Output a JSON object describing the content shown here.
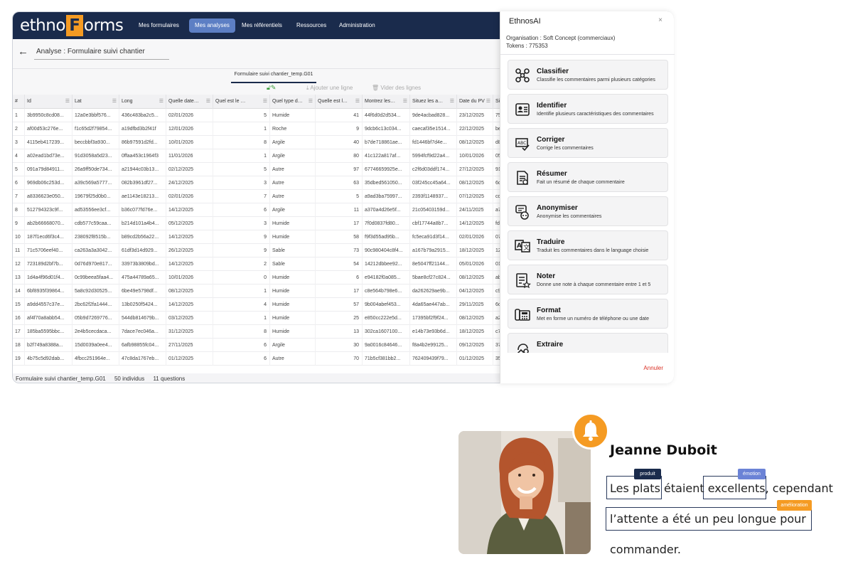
{
  "app": {
    "logo_left": "ethno",
    "logo_box": "F",
    "logo_right": "orms",
    "nav": [
      {
        "label": "Mes formulaires"
      },
      {
        "label": "Mes analyses"
      },
      {
        "label": "Mes référentiels"
      },
      {
        "label": "Ressources"
      },
      {
        "label": "Administration"
      }
    ],
    "page_title": "Analyse : Formulaire suivi chantier",
    "tab": "Formulaire suivi chantier_temp.G01",
    "toolbar": {
      "add_label": "Ajouter une ligne",
      "clear_label": "Vider des lignes"
    }
  },
  "table": {
    "headers": [
      "#",
      "Id",
      "Lat",
      "Long",
      "Quelle date…",
      "Quel est le …",
      "Quel type d…",
      "Quelle est l…",
      "Montrez les…",
      "Situez les a…",
      "Date du PV",
      "Sig"
    ],
    "rows": [
      [
        "1",
        "3b9950c8cd08...",
        "12a0e3bbf576...",
        "436c483ba2c5...",
        "02/01/2026",
        "5",
        "Humide",
        "41",
        "44f6d0d2d534...",
        "9de4acbad828...",
        "23/12/2025",
        "75"
      ],
      [
        "2",
        "af00d53c276e...",
        "f1c65d2f79854...",
        "a19dfbd3b2f41f",
        "12/01/2026",
        "1",
        "Roche",
        "9",
        "9dcb6c13c034...",
        "caecaf35e1514...",
        "22/12/2025",
        "be"
      ],
      [
        "3",
        "4115eb417239...",
        "beccbbf3a930...",
        "86b97591d2fd...",
        "10/01/2026",
        "8",
        "Argile",
        "40",
        "b7de718861ae...",
        "fd1446bf7d4e...",
        "08/12/2025",
        "d8"
      ],
      [
        "4",
        "a02ead1bd73e...",
        "91d3058a5d23...",
        "0ffaa453c1964f3",
        "11/01/2026",
        "1",
        "Argile",
        "80",
        "41c122a817af...",
        "5994fcf9d22a4...",
        "10/01/2026",
        "05"
      ],
      [
        "5",
        "091a79d84911...",
        "26a9ff50de734...",
        "a21944c03b13...",
        "02/12/2025",
        "5",
        "Autre",
        "97",
        "67746659925e...",
        "c2f6d03ddf174...",
        "27/12/2025",
        "91"
      ],
      [
        "6",
        "969db06c253d...",
        "a39c569a5777...",
        "082b3961df27...",
        "24/12/2025",
        "3",
        "Autre",
        "63",
        "35dbed561050...",
        "03f245cc45a64...",
        "08/12/2025",
        "6c"
      ],
      [
        "7",
        "a8336623e050...",
        "19679f25d0b0...",
        "ae1143e18213...",
        "02/01/2026",
        "7",
        "Autre",
        "5",
        "a9ad3ba75997...",
        "2393f1148937...",
        "07/12/2025",
        "cd"
      ],
      [
        "8",
        "512794323c9f...",
        "ad53556ee3cf...",
        "b36c077fd76e...",
        "14/12/2025",
        "6",
        "Argile",
        "11",
        "a370a4d26e5f...",
        "21c05403159d...",
        "24/11/2025",
        "a7"
      ],
      [
        "9",
        "ab2b66668070...",
        "cdb577c59caa...",
        "b214d101a4b4...",
        "05/12/2025",
        "3",
        "Humide",
        "17",
        "7f0d0837fd80...",
        "cbf17744a8b7...",
        "14/12/2025",
        "fd"
      ],
      [
        "10",
        "187f1ecd6f3c4...",
        "238092f8515b...",
        "b89cd2b56a22...",
        "14/12/2025",
        "9",
        "Humide",
        "58",
        "f9f3d55ad95b...",
        "fc5eca91d3f14...",
        "02/01/2026",
        "07"
      ],
      [
        "11",
        "71c5706eef40...",
        "ca263a3a3042...",
        "61df3d14d929...",
        "26/12/2025",
        "9",
        "Sable",
        "73",
        "90c980404c8f4...",
        "a167b79a2915...",
        "18/12/2025",
        "12"
      ],
      [
        "12",
        "723189d2bf7b...",
        "0d76d970e817...",
        "33973b3809bd...",
        "14/12/2025",
        "2",
        "Sable",
        "54",
        "14212dbbee92...",
        "8e5047ff21144...",
        "05/01/2026",
        "01"
      ],
      [
        "13",
        "1d4a4f96d01f4...",
        "0c99beea5faa4...",
        "475a44789a65...",
        "10/01/2026",
        "0",
        "Humide",
        "6",
        "e94182f0a085...",
        "5bae8cf27c824...",
        "08/12/2025",
        "ab"
      ],
      [
        "14",
        "6bf8935f39864...",
        "5a8c92d30525...",
        "6be49e5798df...",
        "08/12/2025",
        "1",
        "Humide",
        "17",
        "c8e564b798e6...",
        "da262629ae9b...",
        "04/12/2025",
        "c9"
      ],
      [
        "15",
        "a9dd4557c37e...",
        "2bc62f2fa1444...",
        "13b0250f5424...",
        "14/12/2025",
        "4",
        "Humide",
        "57",
        "9b004abef453...",
        "4da65ae447ab...",
        "29/11/2025",
        "6c"
      ],
      [
        "16",
        "af4f70a8abb54...",
        "05b9d7269776...",
        "544db814679b...",
        "03/12/2025",
        "1",
        "Humide",
        "25",
        "e850cc222e5d...",
        "17395bf2f9f24...",
        "08/12/2025",
        "a2"
      ],
      [
        "17",
        "185ba5595bbc...",
        "2e4b5cecdaca...",
        "7dace7ec046a...",
        "31/12/2025",
        "8",
        "Humide",
        "13",
        "302ca1607100...",
        "e14b73e93b6d...",
        "18/12/2025",
        "c7"
      ],
      [
        "18",
        "b2f749a8388a...",
        "15d0039a0ee4...",
        "6afb98855fc04...",
        "27/11/2025",
        "6",
        "Argile",
        "30",
        "9a0016c84646...",
        "f8a4b2e99125...",
        "09/12/2025",
        "37"
      ],
      [
        "19",
        "4b75c5d92dab...",
        "4fbcc251964e...",
        "47c8da1767eb...",
        "01/12/2025",
        "6",
        "Autre",
        "70",
        "71b5cf381bb2...",
        "762409439f79...",
        "01/12/2025",
        "35"
      ]
    ]
  },
  "status": {
    "form": "Formulaire suivi chantier_temp.G01",
    "individus": "50 individus",
    "questions": "11 questions"
  },
  "ai_panel": {
    "title": "EthnosAI",
    "close": "×",
    "organisation": "Organisation :  Soft Concept (commerciaux)",
    "tokens": "Tokens :  775353",
    "actions": [
      {
        "name": "Classifier",
        "desc": "Classifie les commentaires parmi plusieurs catégories",
        "icon": "network-icon"
      },
      {
        "name": "Identifier",
        "desc": "Identifie plusieurs caractéristiques des commentaires",
        "icon": "id-card-icon"
      },
      {
        "name": "Corriger",
        "desc": "Corrige les commentaires",
        "icon": "spellcheck-icon"
      },
      {
        "name": "Résumer",
        "desc": "Fait un résumé de chaque commentaire",
        "icon": "document-icon"
      },
      {
        "name": "Anonymiser",
        "desc": "Anonymise les commentaires",
        "icon": "anonymous-icon"
      },
      {
        "name": "Traduire",
        "desc": "Traduit les commentaires dans le language choisie",
        "icon": "translate-icon"
      },
      {
        "name": "Noter",
        "desc": "Donne une note à chaque commentaire entre 1 et 5",
        "icon": "rating-icon"
      },
      {
        "name": "Format",
        "desc": "Met en forme un numéro de téléphone ou une date",
        "icon": "phone-format-icon"
      },
      {
        "name": "Extraire",
        "desc": "",
        "icon": "extract-icon"
      }
    ],
    "cancel": "Annuler"
  },
  "review": {
    "name": "Jeanne Duboit",
    "line1_a": "Les plats",
    "line1_b": "étaient",
    "line1_c": "excellents",
    "line1_d": ", cependant",
    "line2": "l’attente a été un peu longue pour",
    "line3": "commander.",
    "tags": [
      {
        "label": "produit",
        "color": "#1a2b4c"
      },
      {
        "label": "émotion",
        "color": "#6b83d6"
      },
      {
        "label": "amélioration",
        "color": "#f59b23"
      }
    ]
  }
}
